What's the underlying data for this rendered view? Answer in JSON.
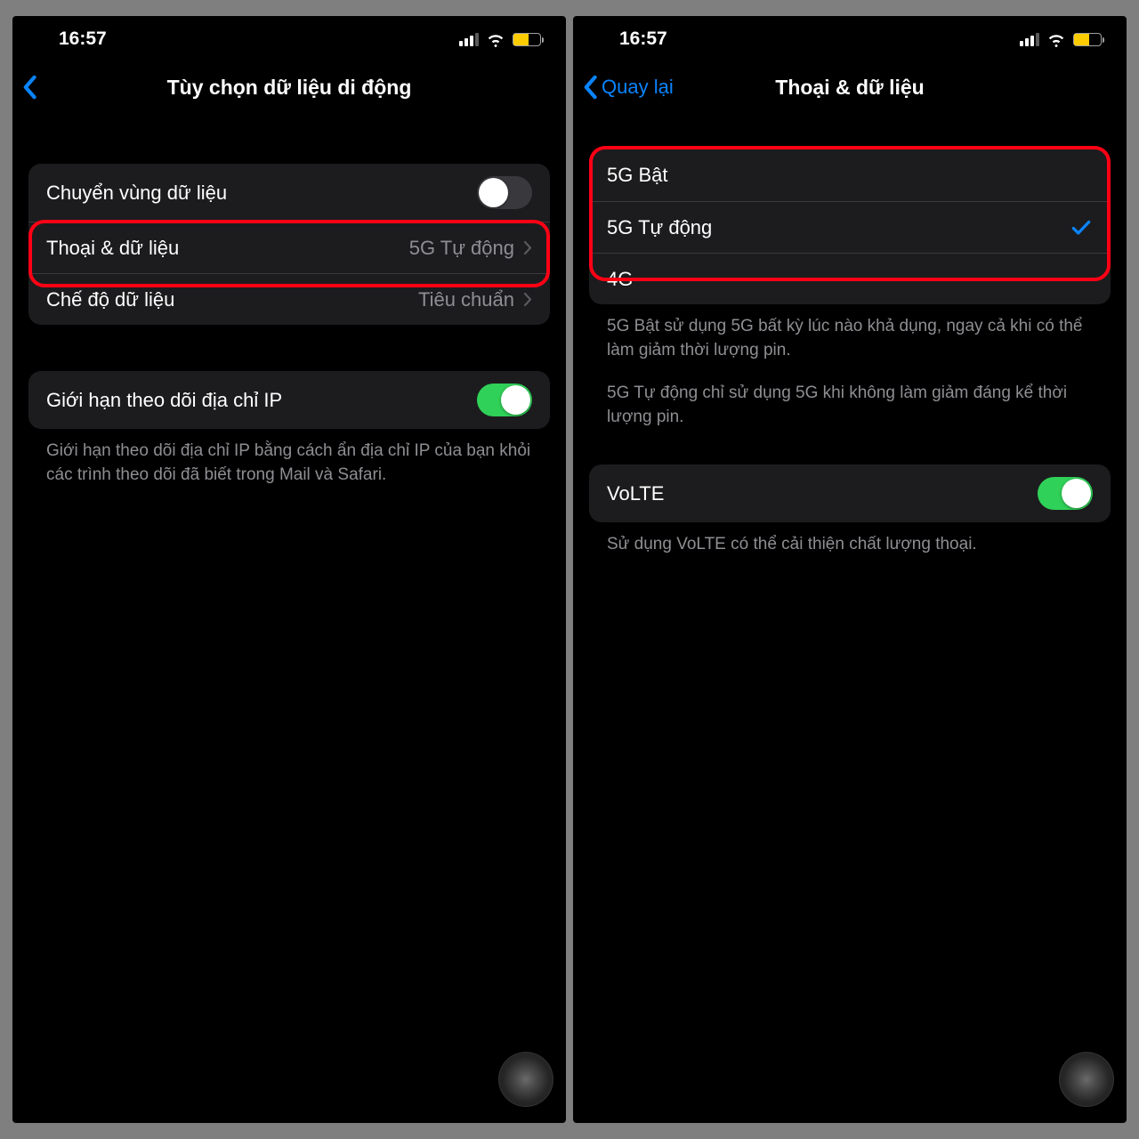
{
  "statusTime": "16:57",
  "left": {
    "title": "Tùy chọn dữ liệu di động",
    "rows": {
      "roaming": "Chuyển vùng dữ liệu",
      "voiceData": "Thoại & dữ liệu",
      "voiceDataValue": "5G Tự động",
      "dataMode": "Chế độ dữ liệu",
      "dataModeValue": "Tiêu chuẩn",
      "limitIp": "Giới hạn theo dõi địa chỉ IP"
    },
    "footer": "Giới hạn theo dõi địa chỉ IP bằng cách ẩn địa chỉ IP của bạn khỏi các trình theo dõi đã biết trong Mail và Safari."
  },
  "right": {
    "back": "Quay lại",
    "title": "Thoại & dữ liệu",
    "options": {
      "opt1": "5G Bật",
      "opt2": "5G Tự động",
      "opt3": "4G"
    },
    "footer1": "5G Bật sử dụng 5G bất kỳ lúc nào khả dụng, ngay cả khi có thể làm giảm thời lượng pin.",
    "footer2": "5G Tự động chỉ sử dụng 5G khi không làm giảm đáng kể thời lượng pin.",
    "volte": "VoLTE",
    "volteFooter": "Sử dụng VoLTE có thể cải thiện chất lượng thoại."
  }
}
